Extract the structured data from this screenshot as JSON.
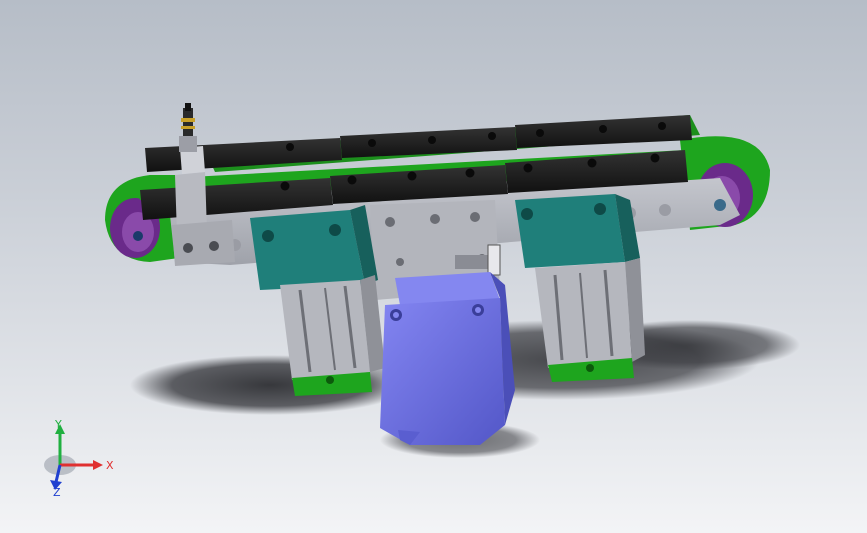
{
  "viewport": {
    "background_top": "#b6bdc7",
    "background_bottom": "#f3f4f6"
  },
  "model": {
    "colors": {
      "belt_green": "#1ea51e",
      "rail_black": "#1c1c1c",
      "plate_grey": "#aeb0b8",
      "bearing_teal": "#1f7f7a",
      "motor_blue": "#6d70e6",
      "pulley_purple": "#6a2a8a",
      "shadow": "#3a3b40"
    }
  },
  "triad": {
    "x_label": "X",
    "y_label": "Y",
    "z_label": "Z",
    "x_color": "#e03030",
    "y_color": "#20b040",
    "z_color": "#2040d0"
  }
}
